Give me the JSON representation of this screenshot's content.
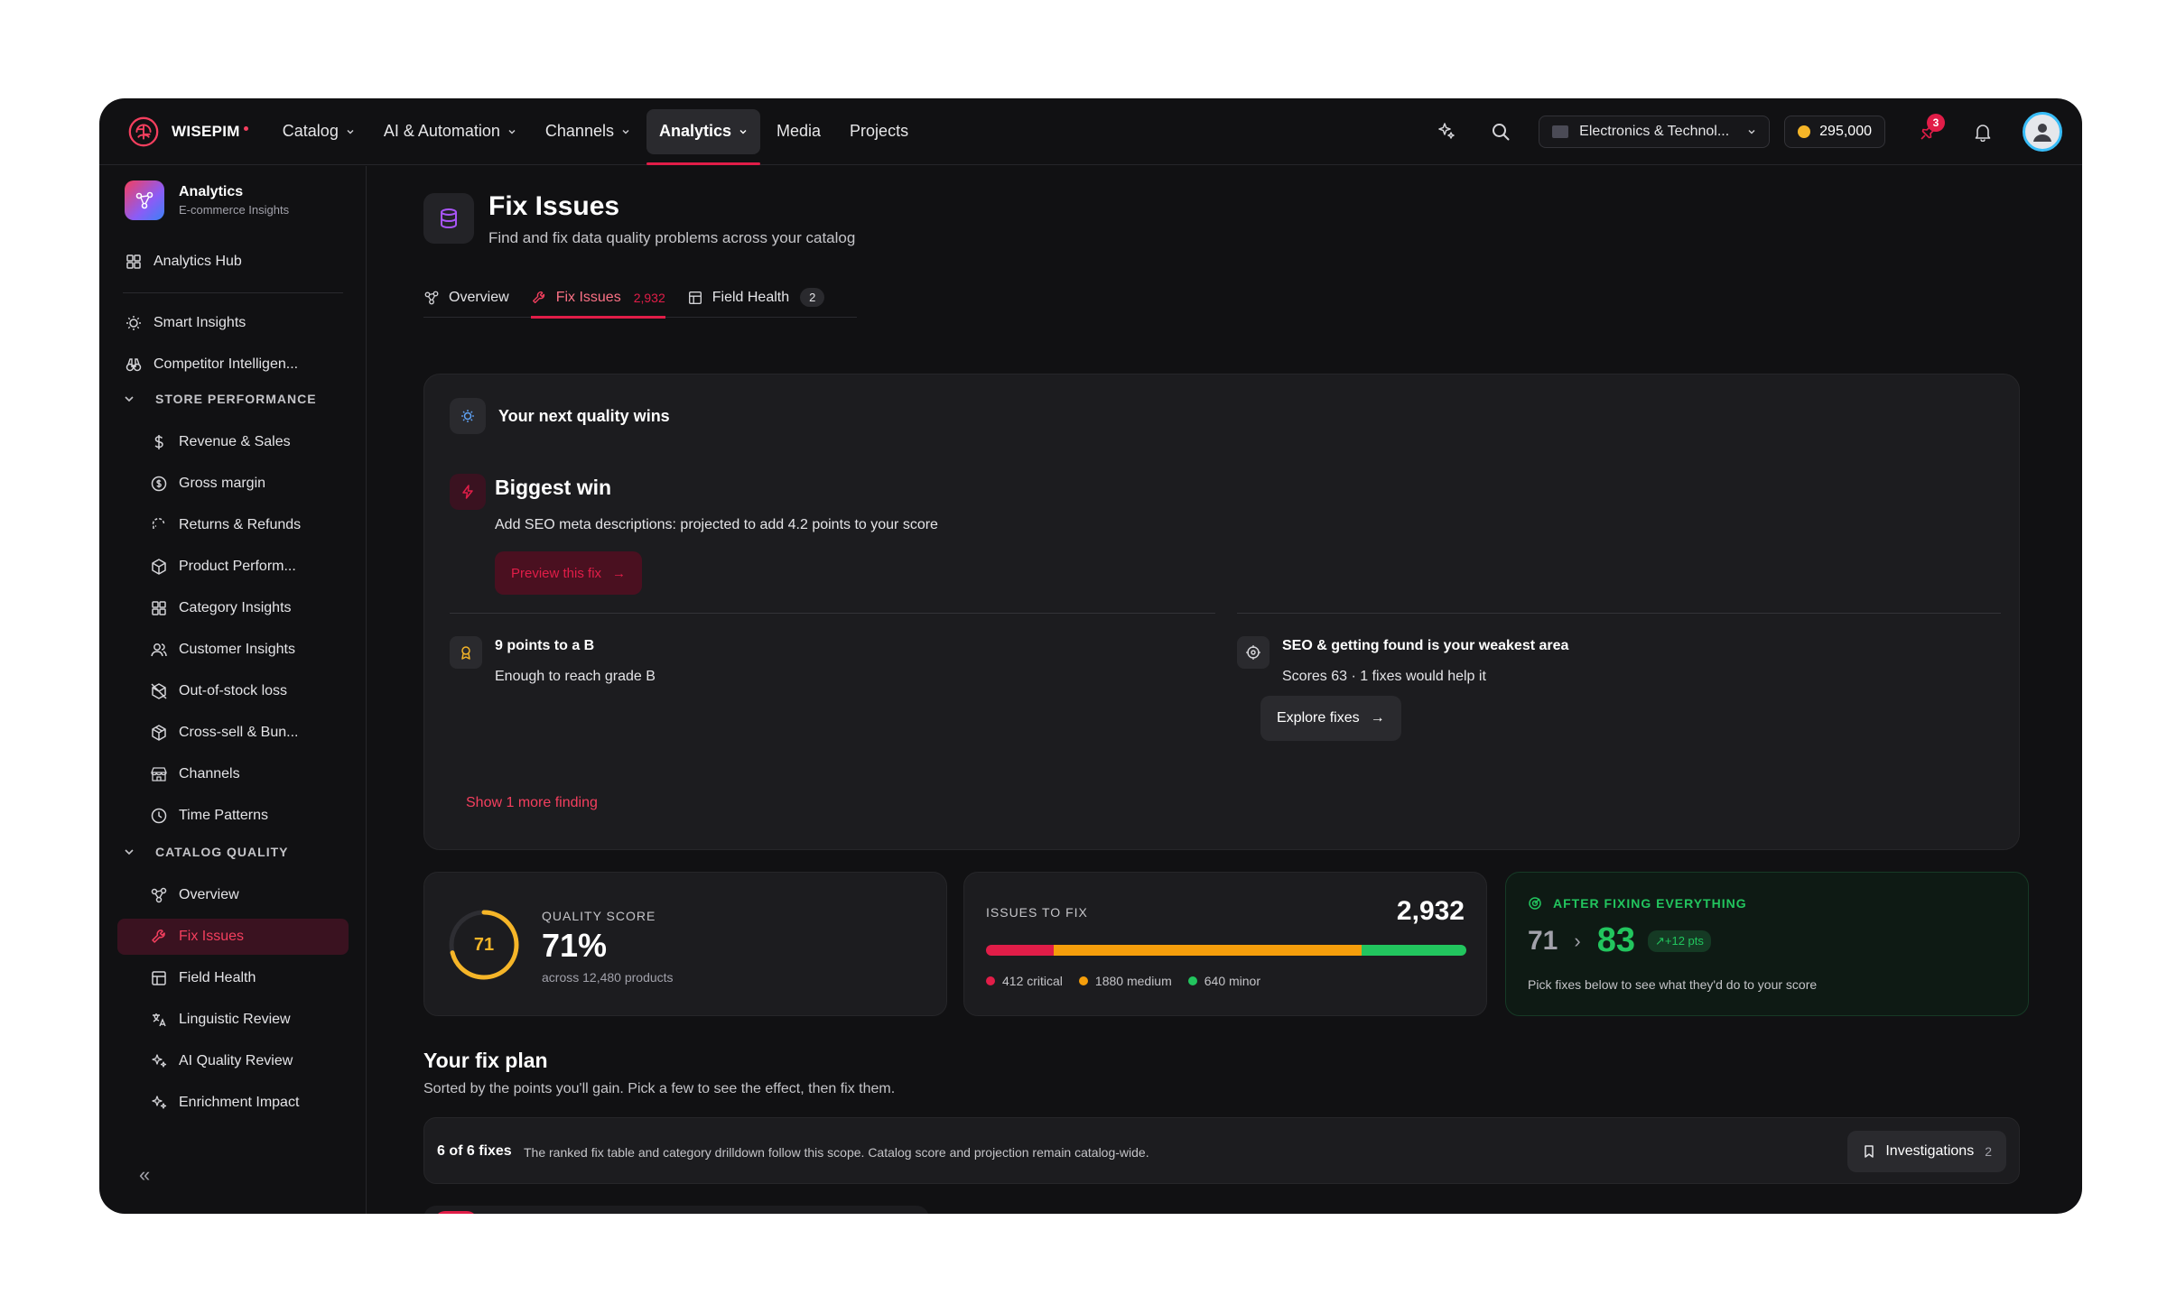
{
  "brand": {
    "name": "WISEPIM",
    "logo_icon": "brain-logo-icon"
  },
  "nav": {
    "items": [
      {
        "label": "Catalog",
        "has_dropdown": true
      },
      {
        "label": "AI & Automation",
        "has_dropdown": true
      },
      {
        "label": "Channels",
        "has_dropdown": true
      },
      {
        "label": "Analytics",
        "has_dropdown": true,
        "active": true
      },
      {
        "label": "Media",
        "has_dropdown": false
      },
      {
        "label": "Projects",
        "has_dropdown": false
      }
    ]
  },
  "topbar": {
    "org": "Electronics & Technol...",
    "credits": "295,000",
    "notification_count": "3"
  },
  "sidebar": {
    "title": "Analytics",
    "subtitle": "E-commerce Insights",
    "hub": "Analytics Hub",
    "top_items": [
      {
        "label": "Smart Insights",
        "icon": "bulb-icon"
      },
      {
        "label": "Competitor Intelligen...",
        "icon": "binoculars-icon"
      }
    ],
    "section_store": "STORE PERFORMANCE",
    "store_items": [
      {
        "label": "Revenue & Sales",
        "icon": "dollar-icon"
      },
      {
        "label": "Gross margin",
        "icon": "coin-icon"
      },
      {
        "label": "Returns & Refunds",
        "icon": "return-icon"
      },
      {
        "label": "Product Perform...",
        "icon": "box-icon"
      },
      {
        "label": "Category Insights",
        "icon": "grid-icon"
      },
      {
        "label": "Customer Insights",
        "icon": "users-icon"
      },
      {
        "label": "Out-of-stock loss",
        "icon": "package-off-icon"
      },
      {
        "label": "Cross-sell & Bun...",
        "icon": "bundle-icon"
      },
      {
        "label": "Channels",
        "icon": "store-icon"
      },
      {
        "label": "Time Patterns",
        "icon": "clock-icon"
      }
    ],
    "section_quality": "CATALOG QUALITY",
    "quality_items": [
      {
        "label": "Overview",
        "icon": "share-icon"
      },
      {
        "label": "Fix Issues",
        "icon": "wrench-icon",
        "active": true
      },
      {
        "label": "Field Health",
        "icon": "table-icon"
      },
      {
        "label": "Linguistic Review",
        "icon": "translate-icon"
      },
      {
        "label": "AI Quality Review",
        "icon": "sparkles-icon"
      },
      {
        "label": "Enrichment Impact",
        "icon": "sparkles-icon"
      }
    ],
    "collapse": "«"
  },
  "page": {
    "title": "Fix Issues",
    "subtitle": "Find and fix data quality problems across your catalog"
  },
  "tabs": [
    {
      "label": "Overview"
    },
    {
      "label": "Fix Issues",
      "count": "2,932",
      "active": true
    },
    {
      "label": "Field Health",
      "count": "2"
    }
  ],
  "wins": {
    "heading": "Your next quality wins",
    "biggest_title": "Biggest win",
    "biggest_desc": "Add SEO meta descriptions: projected to add 4.2 points to your score",
    "preview_btn": "Preview this fix",
    "grade_title": "9 points to a B",
    "grade_desc": "Enough to reach grade B",
    "weak_title": "SEO & getting found is your weakest area",
    "weak_desc": "Scores 63 · 1 fixes would help it",
    "explore_btn": "Explore fixes",
    "show_more": "Show 1 more finding"
  },
  "quality_score": {
    "label": "QUALITY SCORE",
    "gauge_value": "71",
    "gauge_fraction": 0.71,
    "value": "71%",
    "sub": "across 12,480 products"
  },
  "issues": {
    "label": "ISSUES TO FIX",
    "total": "2,932",
    "critical": 412,
    "medium": 1880,
    "minor": 640,
    "critical_label": "412 critical",
    "medium_label": "1880 medium",
    "minor_label": "640 minor",
    "colors": {
      "critical": "#e11d48",
      "medium": "#f59e0b",
      "minor": "#22c55e"
    }
  },
  "after": {
    "label": "AFTER FIXING EVERYTHING",
    "from": "71",
    "to": "83",
    "pts": "+12 pts",
    "sub": "Pick fixes below to see what they'd do to your score"
  },
  "plan": {
    "title": "Your fix plan",
    "subtitle": "Sorted by the points you'll gain. Pick a few to see the effect, then fix them.",
    "scope_count": "6 of 6 fixes",
    "scope_text": "The ranked fix table and category drilldown follow this scope. Catalog score and projection remain catalog-wide.",
    "investigations_label": "Investigations",
    "investigations_count": "2"
  },
  "colors": {
    "accent": "#e11d48",
    "bg": "#111113",
    "card": "#1c1c1f",
    "success": "#22c55e",
    "warning": "#f5b528"
  }
}
